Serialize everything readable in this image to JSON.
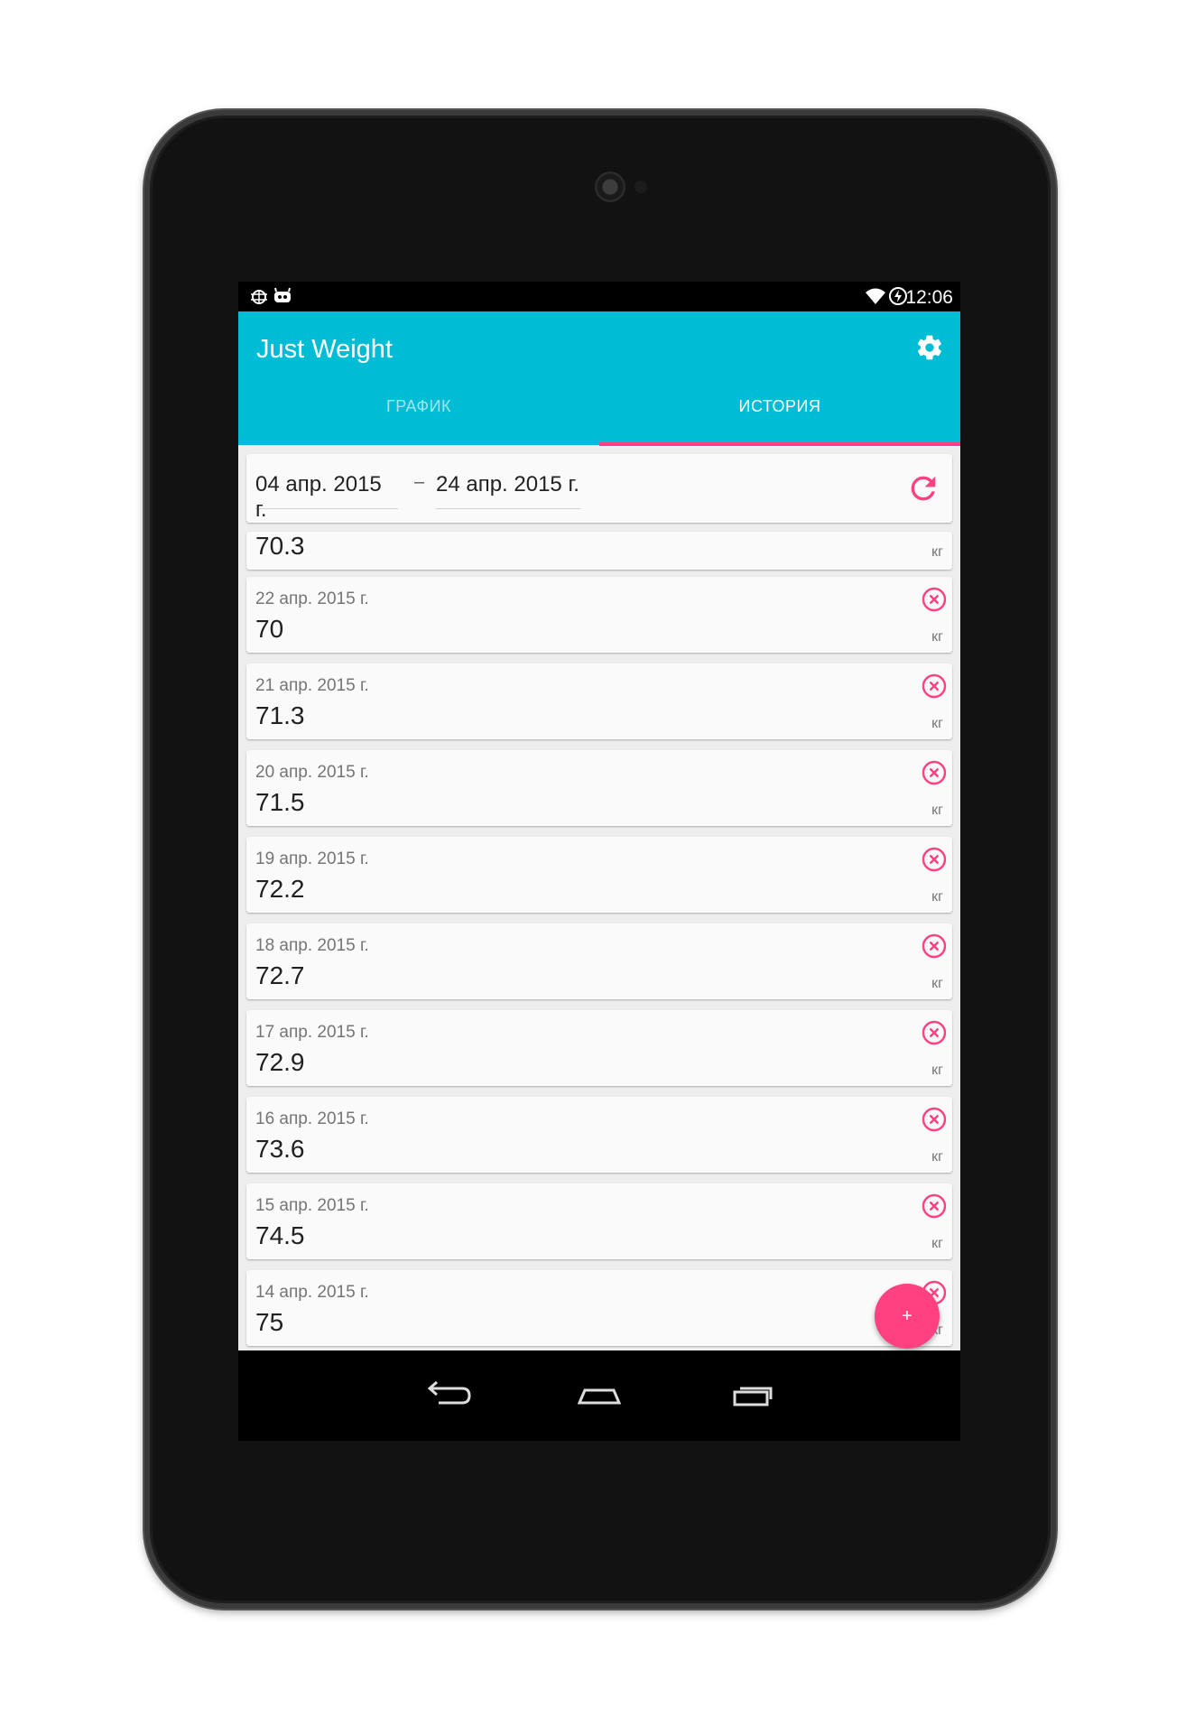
{
  "status_bar": {
    "time": "12:06",
    "left_icons": [
      "debug-bug-icon",
      "cyanogen-mascot-icon"
    ],
    "right_icons": [
      "wifi-icon",
      "battery-charging-icon"
    ]
  },
  "app_bar": {
    "title": "Just Weight",
    "settings_icon": "gear-icon",
    "tabs": [
      {
        "label": "ГРАФИК",
        "selected": false
      },
      {
        "label": "ИСТОРИЯ",
        "selected": true
      }
    ]
  },
  "colors": {
    "primary": "#00bcd4",
    "accent": "#ff4081"
  },
  "date_range": {
    "from": "04 апр. 2015 г.",
    "separator": "–",
    "to": "24 апр. 2015 г.",
    "refresh_icon": "refresh-icon"
  },
  "partial_entry": {
    "value": "70.3",
    "unit": "кг"
  },
  "entries": [
    {
      "date": "22 апр. 2015 г.",
      "value": "70",
      "unit": "кг"
    },
    {
      "date": "21 апр. 2015 г.",
      "value": "71.3",
      "unit": "кг"
    },
    {
      "date": "20 апр. 2015 г.",
      "value": "71.5",
      "unit": "кг"
    },
    {
      "date": "19 апр. 2015 г.",
      "value": "72.2",
      "unit": "кг"
    },
    {
      "date": "18 апр. 2015 г.",
      "value": "72.7",
      "unit": "кг"
    },
    {
      "date": "17 апр. 2015 г.",
      "value": "72.9",
      "unit": "кг"
    },
    {
      "date": "16 апр. 2015 г.",
      "value": "73.6",
      "unit": "кг"
    },
    {
      "date": "15 апр. 2015 г.",
      "value": "74.5",
      "unit": "кг"
    },
    {
      "date": "14 апр. 2015 г.",
      "value": "75",
      "unit": "кг"
    }
  ],
  "fab": {
    "label": "+"
  },
  "nav_bar": {
    "icons": [
      "back-icon",
      "home-icon",
      "recents-icon"
    ]
  }
}
